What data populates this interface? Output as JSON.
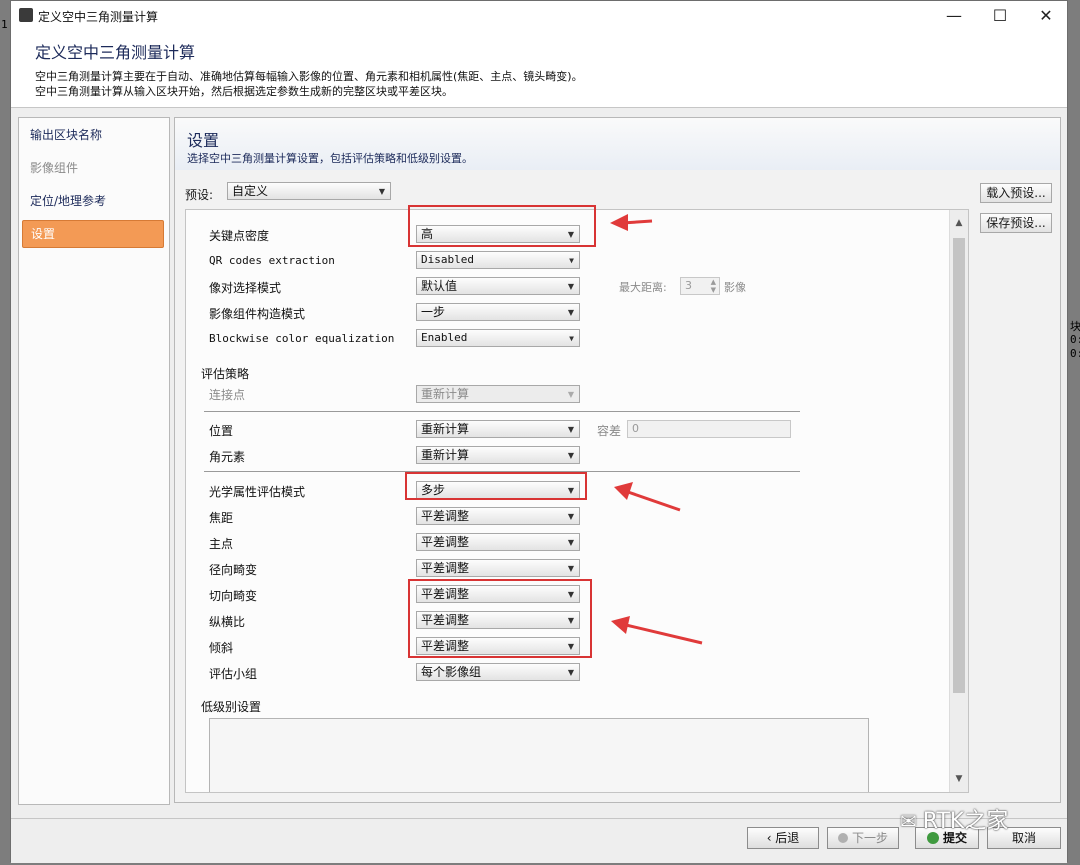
{
  "window": {
    "title": "定义空中三角测量计算",
    "minimize": "—",
    "maximize": "☐",
    "close": "✕"
  },
  "header": {
    "title": "定义空中三角测量计算",
    "desc_line1": "空中三角测量计算主要在于自动、准确地估算每幅输入影像的位置、角元素和相机属性(焦距、主点、镜头畸变)。",
    "desc_line2": "空中三角测量计算从输入区块开始，然后根据选定参数生成新的完整区块或平差区块。"
  },
  "nav": {
    "items": [
      {
        "label": "输出区块名称"
      },
      {
        "label": "影像组件"
      },
      {
        "label": "定位/地理参考"
      },
      {
        "label": "设置"
      }
    ]
  },
  "main": {
    "title": "设置",
    "subtitle": "选择空中三角测量计算设置，包括评估策略和低级别设置。",
    "preset_label": "预设:",
    "preset_value": "自定义",
    "load_preset": "载入预设...",
    "save_preset": "保存预设..."
  },
  "settings": {
    "keypoint_density": {
      "label": "关键点密度",
      "value": "高"
    },
    "qr_codes": {
      "label": "QR codes extraction",
      "value": "Disabled"
    },
    "pair_selection": {
      "label": "像对选择模式",
      "value": "默认值",
      "max_dist_label": "最大距离:",
      "max_dist_value": "3",
      "max_dist_unit": "影像"
    },
    "component_mode": {
      "label": "影像组件构造模式",
      "value": "一步"
    },
    "color_eq": {
      "label": "Blockwise color equalization",
      "value": "Enabled"
    }
  },
  "estimation": {
    "section_label": "评估策略",
    "tie_points": {
      "label": "连接点",
      "value": "重新计算"
    },
    "position": {
      "label": "位置",
      "value": "重新计算",
      "tolerance_label": "容差",
      "tolerance_value": "0"
    },
    "rotation": {
      "label": "角元素",
      "value": "重新计算"
    },
    "optics_mode": {
      "label": "光学属性评估模式",
      "value": "多步"
    },
    "focal": {
      "label": "焦距",
      "value": "平差调整"
    },
    "principal": {
      "label": "主点",
      "value": "平差调整"
    },
    "radial": {
      "label": "径向畸变",
      "value": "平差调整"
    },
    "tangential": {
      "label": "切向畸变",
      "value": "平差调整"
    },
    "aspect": {
      "label": "纵横比",
      "value": "平差调整"
    },
    "skew": {
      "label": "倾斜",
      "value": "平差调整"
    },
    "group": {
      "label": "评估小组",
      "value": "每个影像组"
    }
  },
  "low_level": {
    "label": "低级别设置"
  },
  "footer": {
    "back": "‹ 后退",
    "next": "下一步",
    "submit": "提交",
    "cancel": "取消"
  },
  "watermark": "RTK之家"
}
